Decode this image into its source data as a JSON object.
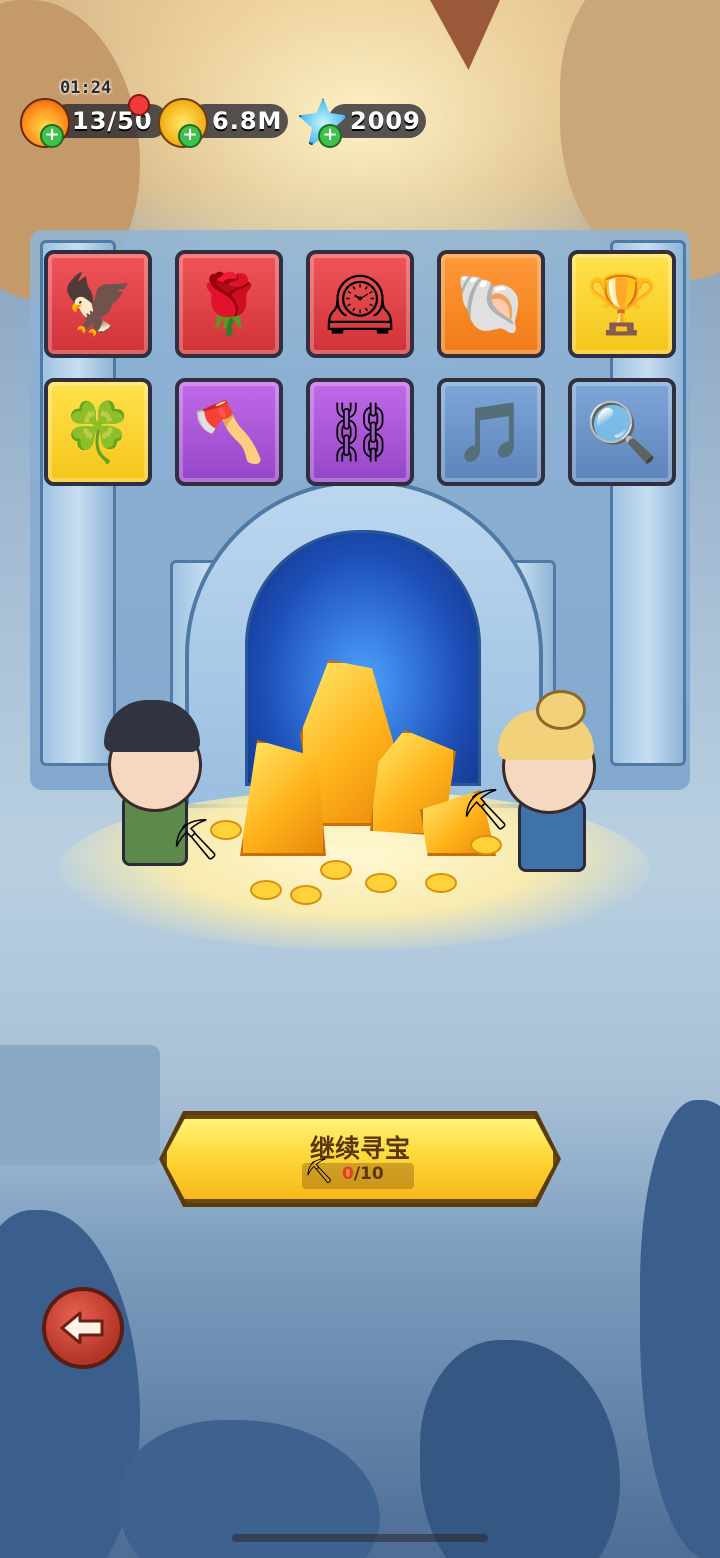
{
  "hud": {
    "timer": "01:24",
    "energy": "13/50",
    "gold": "6.8M",
    "gems": "2009",
    "icons": [
      "flame-icon",
      "gold-coin-icon",
      "blue-gem-icon"
    ]
  },
  "items": [
    {
      "name": "ice-eagle-statue",
      "rarity": "red",
      "glyph": "🦅"
    },
    {
      "name": "rose-birdcage",
      "rarity": "red",
      "glyph": "🌹"
    },
    {
      "name": "winged-clock",
      "rarity": "red",
      "glyph": "🕰"
    },
    {
      "name": "blue-pearl-shell",
      "rarity": "orange",
      "glyph": "🐚"
    },
    {
      "name": "golden-goblet",
      "rarity": "yellow",
      "glyph": "🏆"
    },
    {
      "name": "clover-ring",
      "rarity": "yellow",
      "glyph": "🍀"
    },
    {
      "name": "stone-axe",
      "rarity": "purple",
      "glyph": "🪓"
    },
    {
      "name": "vine-shackles",
      "rarity": "purple",
      "glyph": "⛓"
    },
    {
      "name": "golden-lyre",
      "rarity": "blue",
      "glyph": "🎵"
    },
    {
      "name": "pocket-mirror",
      "rarity": "blue",
      "glyph": "🔍"
    }
  ],
  "continue_button": {
    "label": "继续寻宝",
    "progress_current": "0",
    "progress_total": "/10"
  },
  "colors": {
    "rarity_red": "#e04247",
    "rarity_orange": "#f58a25",
    "rarity_yellow": "#f8d22e",
    "rarity_purple": "#aa55d8",
    "rarity_blue": "#6d94c9",
    "button_gold": "#ffd93a"
  }
}
